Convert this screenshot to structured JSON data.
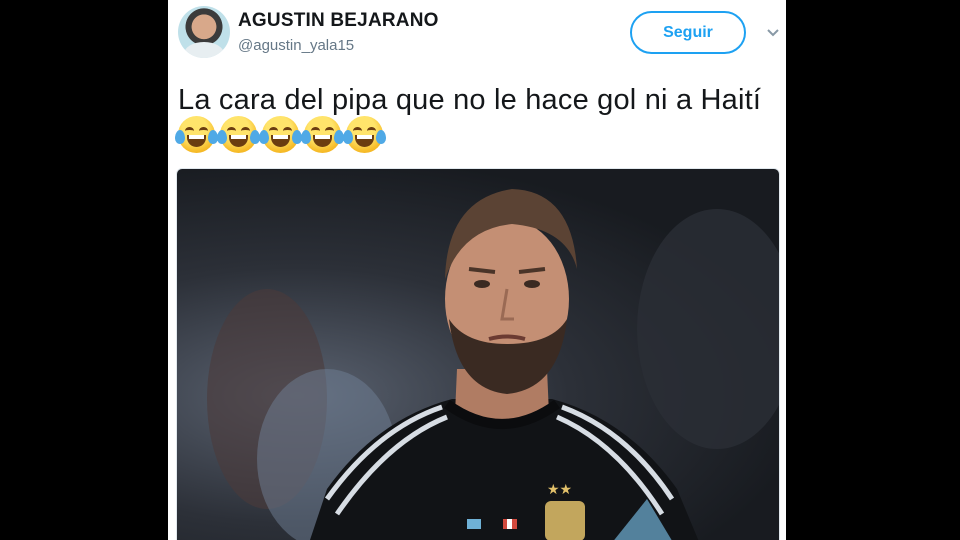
{
  "tweet": {
    "display_name": "AGUSTIN BEJARANO",
    "handle": "@agustin_yala15",
    "follow_label": "Seguir",
    "text": "La cara del pipa que no le hace gol ni a Haití",
    "emoji_count": 5,
    "emoji": "face-with-tears-of-joy"
  },
  "colors": {
    "accent": "#1da1f2",
    "name": "#14171a",
    "handle": "#657786"
  }
}
